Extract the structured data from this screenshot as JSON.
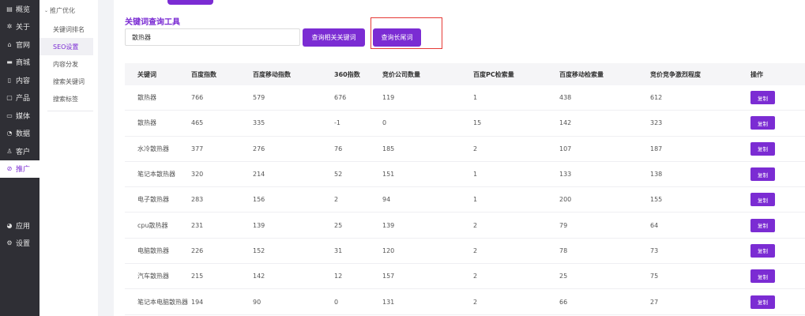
{
  "nav": {
    "items": [
      {
        "icon": "overview-icon",
        "glyph": "▤",
        "label": "概览"
      },
      {
        "icon": "gear-icon",
        "glyph": "✲",
        "label": "关于"
      },
      {
        "icon": "home-icon",
        "glyph": "⌂",
        "label": "官网"
      },
      {
        "icon": "store-icon",
        "glyph": "▬",
        "label": "商城"
      },
      {
        "icon": "document-icon",
        "glyph": "▯",
        "label": "内容"
      },
      {
        "icon": "product-icon",
        "glyph": "▢",
        "label": "产品"
      },
      {
        "icon": "media-icon",
        "glyph": "▭",
        "label": "媒体"
      },
      {
        "icon": "chart-icon",
        "glyph": "◔",
        "label": "数据"
      },
      {
        "icon": "user-icon",
        "glyph": "♙",
        "label": "客户"
      },
      {
        "icon": "promote-icon",
        "glyph": "⊘",
        "label": "推广"
      }
    ],
    "lower_items": [
      {
        "icon": "apps-icon",
        "glyph": "◕",
        "label": "应用"
      },
      {
        "icon": "settings-icon",
        "glyph": "⚙",
        "label": "设置"
      }
    ]
  },
  "subnav": {
    "header": "推广优化",
    "items": [
      {
        "label": "关键词排名"
      },
      {
        "label": "SEO设置"
      },
      {
        "label": "内容分发"
      },
      {
        "label": "搜索关键词"
      },
      {
        "label": "搜索标签"
      }
    ]
  },
  "tool": {
    "title": "关键词查询工具",
    "input_value": "散热器",
    "btn_related": "查询相关关键词",
    "btn_long": "查询长尾词"
  },
  "table": {
    "columns": [
      "关键词",
      "百度指数",
      "百度移动指数",
      "360指数",
      "竞价公司数量",
      "百度PC检索量",
      "百度移动检索量",
      "竞价竞争激烈程度",
      "操作"
    ],
    "action_label": "复制",
    "rows": [
      [
        "散热器",
        "766",
        "579",
        "676",
        "119",
        "1",
        "438",
        "612"
      ],
      [
        "散热器",
        "465",
        "335",
        "-1",
        "0",
        "15",
        "142",
        "323"
      ],
      [
        "水冷散热器",
        "377",
        "276",
        "76",
        "185",
        "2",
        "107",
        "187"
      ],
      [
        "笔记本散热器",
        "320",
        "214",
        "52",
        "151",
        "1",
        "133",
        "138"
      ],
      [
        "电子散热器",
        "283",
        "156",
        "2",
        "94",
        "1",
        "200",
        "155"
      ],
      [
        "cpu散热器",
        "231",
        "139",
        "25",
        "139",
        "2",
        "79",
        "64"
      ],
      [
        "电脑散热器",
        "226",
        "152",
        "31",
        "120",
        "2",
        "78",
        "73"
      ],
      [
        "汽车散热器",
        "215",
        "142",
        "12",
        "157",
        "2",
        "25",
        "75"
      ],
      [
        "笔记本电脑散热器",
        "194",
        "90",
        "0",
        "131",
        "2",
        "66",
        "27"
      ]
    ]
  },
  "colors": {
    "accent": "#7b2cd3",
    "sidebar_bg": "#2f2f35",
    "highlight_border": "#e53935"
  }
}
